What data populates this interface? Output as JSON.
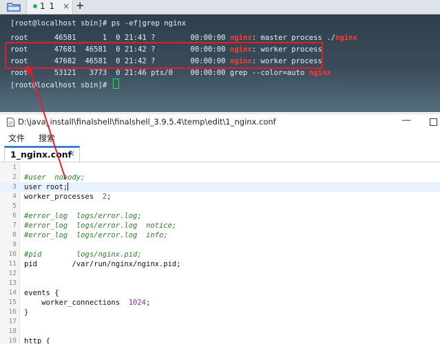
{
  "terminal": {
    "tab_label": "1 1",
    "tab_close": "×",
    "tab_add": "+",
    "lines": [
      {
        "pre": "[root@localhost sbin]# ps -ef|grep nginx",
        "hl": "",
        "post": "",
        "hl2": ""
      },
      {
        "pre": "root      46581      1  0 21:41 ?        00:00:00 ",
        "hl": "nginx",
        "post": ": master process ./",
        "hl2": "nginx"
      },
      {
        "pre": "root      47681  46581  0 21:42 ?        00:00:00 ",
        "hl": "nginx",
        "post": ": worker process",
        "hl2": ""
      },
      {
        "pre": "root      47682  46581  0 21:42 ?        00:00:00 ",
        "hl": "nginx",
        "post": ": worker process",
        "hl2": ""
      },
      {
        "pre": "root      53121   3773  0 21:46 pts/0    00:00:00 grep --color=auto ",
        "hl": "nginx",
        "post": "",
        "hl2": ""
      },
      {
        "pre": "[root@localhost sbin]# ",
        "hl": "",
        "post": "",
        "hl2": ""
      }
    ]
  },
  "editor": {
    "title": "D:\\java_install\\finalshell\\finalshell_3.9.5.4\\temp\\edit\\1_nginx.conf",
    "min_glyph": "—",
    "menu": [
      "文件",
      "搜索"
    ],
    "tab_label": "1_nginx.conf",
    "tab_close": "×",
    "lines": [
      {
        "n": "1",
        "text": "",
        "type": "plain"
      },
      {
        "n": "2",
        "text": "#user  nobody;",
        "type": "comment"
      },
      {
        "n": "3",
        "text": "user root;",
        "type": "plain",
        "current": true
      },
      {
        "n": "4",
        "text": "worker_processes  ",
        "type": "plain",
        "num": "2",
        "tail": ";"
      },
      {
        "n": "5",
        "text": "",
        "type": "plain"
      },
      {
        "n": "6",
        "text": "#error_log  logs/error.log;",
        "type": "comment"
      },
      {
        "n": "7",
        "text": "#error_log  logs/error.log  notice;",
        "type": "comment"
      },
      {
        "n": "8",
        "text": "#error_log  logs/error.log  info;",
        "type": "comment"
      },
      {
        "n": "9",
        "text": "",
        "type": "plain"
      },
      {
        "n": "10",
        "text": "#pid        logs/nginx.pid;",
        "type": "comment"
      },
      {
        "n": "11",
        "text": "pid        /var/run/nginx/nginx.pid;",
        "type": "plain"
      },
      {
        "n": "12",
        "text": "",
        "type": "plain"
      },
      {
        "n": "13",
        "text": "",
        "type": "plain"
      },
      {
        "n": "14",
        "text": "events {",
        "type": "plain"
      },
      {
        "n": "15",
        "text": "    worker_connections  ",
        "type": "plain",
        "num": "1024",
        "tail": ";"
      },
      {
        "n": "16",
        "text": "}",
        "type": "plain"
      },
      {
        "n": "17",
        "text": "",
        "type": "plain"
      },
      {
        "n": "18",
        "text": "",
        "type": "plain"
      },
      {
        "n": "19",
        "text": "http {",
        "type": "plain"
      }
    ]
  },
  "colors": {
    "highlight": "#ff3b30",
    "annotation": "#e41e26",
    "comment": "#2a7f2a",
    "number": "#8b2fb0",
    "tab_accent": "#3f7fd0"
  }
}
